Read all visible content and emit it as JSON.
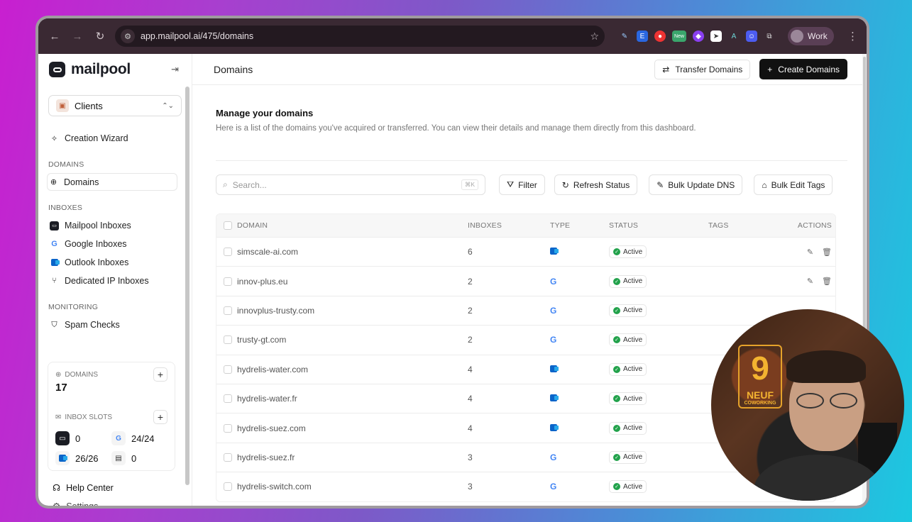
{
  "browser": {
    "url": "app.mailpool.ai/475/domains",
    "profile": "Work",
    "ext_new_badge": "New"
  },
  "sidebar": {
    "logo": "mailpool",
    "client_select": "Clients",
    "wizard": "Creation Wizard",
    "sections": {
      "domains": "DOMAINS",
      "inboxes": "INBOXES",
      "monitoring": "MONITORING"
    },
    "domains_item": "Domains",
    "inboxes": [
      {
        "label": "Mailpool Inboxes",
        "icon": "mailpool-icon"
      },
      {
        "label": "Google Inboxes",
        "icon": "google-icon"
      },
      {
        "label": "Outlook Inboxes",
        "icon": "outlook-icon"
      },
      {
        "label": "Dedicated IP Inboxes",
        "icon": "network-icon"
      }
    ],
    "spam_checks": "Spam Checks",
    "stats": {
      "domains_label": "DOMAINS",
      "domains_count": "17",
      "slots_label": "INBOX SLOTS",
      "mailpool": "0",
      "google": "24/24",
      "outlook": "26/26",
      "other": "0"
    },
    "help": "Help Center",
    "settings": "Settings"
  },
  "header": {
    "title": "Domains",
    "transfer": "Transfer Domains",
    "create": "Create Domains"
  },
  "main": {
    "heading": "Manage your domains",
    "subheading": "Here is a list of the domains you've acquired or transferred. You can view their details and manage them directly from this dashboard.",
    "search_placeholder": "Search...",
    "search_kbd": "⌘K",
    "filter": "Filter",
    "refresh": "Refresh Status",
    "bulk_dns": "Bulk Update DNS",
    "bulk_tags": "Bulk Edit Tags"
  },
  "table": {
    "columns": {
      "domain": "DOMAIN",
      "inboxes": "INBOXES",
      "type": "TYPE",
      "status": "STATUS",
      "tags": "TAGS",
      "actions": "ACTIONS"
    },
    "rows": [
      {
        "domain": "simscale-ai.com",
        "inboxes": "6",
        "type": "outlook",
        "status": "Active"
      },
      {
        "domain": "innov-plus.eu",
        "inboxes": "2",
        "type": "google",
        "status": "Active"
      },
      {
        "domain": "innovplus-trusty.com",
        "inboxes": "2",
        "type": "google",
        "status": "Active"
      },
      {
        "domain": "trusty-gt.com",
        "inboxes": "2",
        "type": "google",
        "status": "Active"
      },
      {
        "domain": "hydrelis-water.com",
        "inboxes": "4",
        "type": "outlook",
        "status": "Active"
      },
      {
        "domain": "hydrelis-water.fr",
        "inboxes": "4",
        "type": "outlook",
        "status": "Active"
      },
      {
        "domain": "hydrelis-suez.com",
        "inboxes": "4",
        "type": "outlook",
        "status": "Active"
      },
      {
        "domain": "hydrelis-suez.fr",
        "inboxes": "3",
        "type": "google",
        "status": "Active"
      },
      {
        "domain": "hydrelis-switch.com",
        "inboxes": "3",
        "type": "google",
        "status": "Active"
      }
    ]
  },
  "webcam": {
    "sign_number": "9",
    "sign_text": "NEUF",
    "sign_sub": "COWORKING"
  },
  "colors": {
    "accent": "#111111",
    "active": "#22a24b",
    "google_blue": "#4285f4",
    "outlook_blue": "#0a64c9"
  }
}
